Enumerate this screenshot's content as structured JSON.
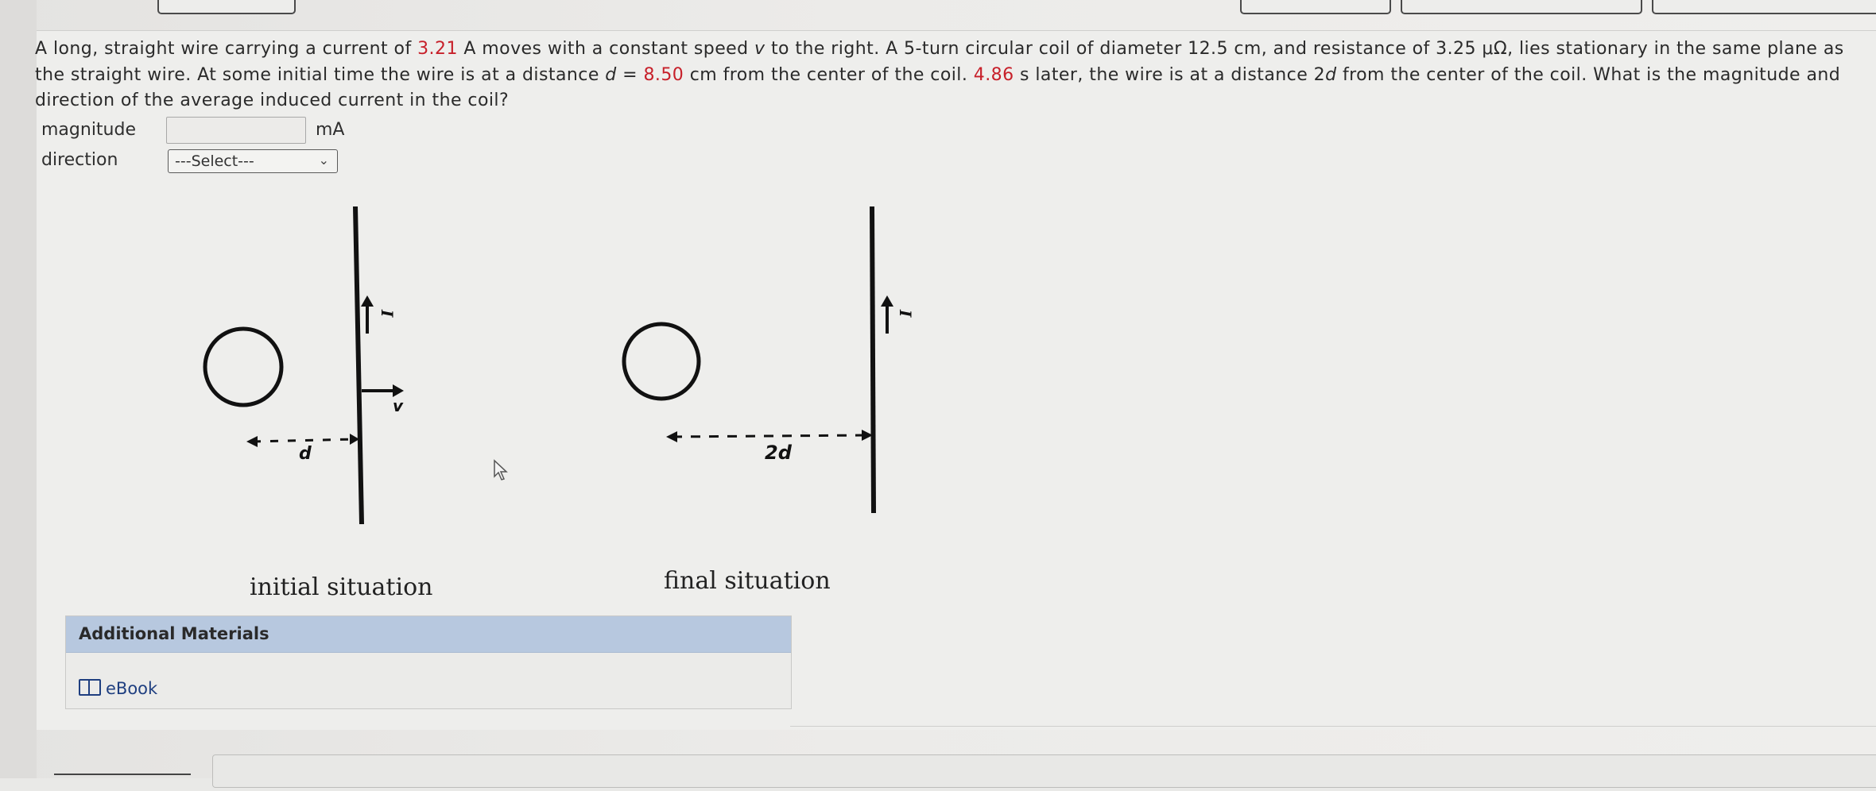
{
  "question": {
    "p1": "A long, straight wire carrying a current of ",
    "current": "3.21",
    "p2": " A moves with a constant speed ",
    "v_symbol": "v",
    "p3": " to the right. A 5-turn circular coil of diameter 12.5 cm, and resistance of 3.25 μΩ, lies stationary in the same plane as the straight wire. At some initial time the wire is at a distance ",
    "d_symbol": "d",
    "p4": " = ",
    "distance": "8.50",
    "p5": " cm from the center of the coil. ",
    "time": "4.86",
    "p6": " s later, the wire is at a distance 2",
    "d_symbol2": "d",
    "p7": " from the center of the coil. What is the magnitude and direction of the average induced current in the coil?"
  },
  "answer": {
    "magnitude_label": "magnitude",
    "magnitude_value": "",
    "unit": "mA",
    "direction_label": "direction",
    "direction_selected": "---Select---"
  },
  "figure": {
    "initial": {
      "current_label": "I",
      "velocity_label": "v",
      "distance_label": "d",
      "caption": "initial situation"
    },
    "final": {
      "current_label": "I",
      "distance_label": "2d",
      "caption": "final situation"
    }
  },
  "additional_materials": {
    "header": "Additional Materials",
    "ebook_label": "eBook"
  }
}
